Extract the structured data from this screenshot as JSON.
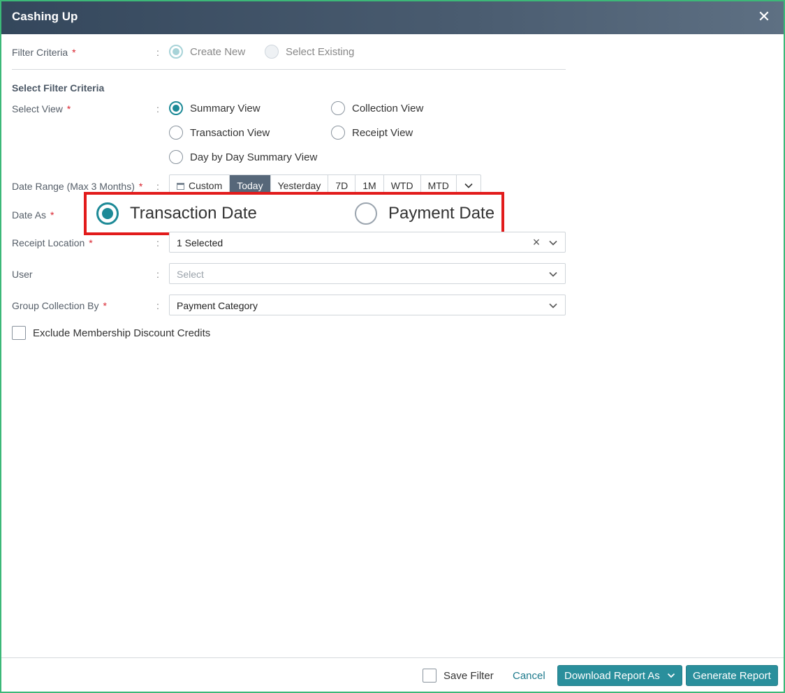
{
  "window": {
    "title": "Cashing Up"
  },
  "filter_criteria": {
    "label": "Filter Criteria",
    "required": "*",
    "options": [
      {
        "label": "Create New",
        "selected": true,
        "disabled": true
      },
      {
        "label": "Select Existing",
        "selected": false,
        "disabled": true
      }
    ]
  },
  "section_title": "Select Filter Criteria",
  "select_view": {
    "label": "Select View",
    "required": "*",
    "options": [
      {
        "label": "Summary View",
        "selected": true
      },
      {
        "label": "Collection View",
        "selected": false
      },
      {
        "label": "Transaction View",
        "selected": false
      },
      {
        "label": "Receipt View",
        "selected": false
      },
      {
        "label": "Day by Day Summary View",
        "selected": false
      }
    ]
  },
  "date_range": {
    "label": "Date Range (Max 3 Months)",
    "required": "*",
    "buttons": [
      "Custom",
      "Today",
      "Yesterday",
      "7D",
      "1M",
      "WTD",
      "MTD"
    ],
    "active": "Today"
  },
  "date_as": {
    "label": "Date As",
    "required": "*",
    "options": [
      {
        "label": "Transaction Date",
        "selected": true
      },
      {
        "label": "Payment Date",
        "selected": false
      }
    ]
  },
  "receipt_location": {
    "label": "Receipt Location",
    "required": "*",
    "value": "1 Selected"
  },
  "user": {
    "label": "User",
    "placeholder": "Select"
  },
  "group_collection_by": {
    "label": "Group Collection By",
    "required": "*",
    "value": "Payment Category"
  },
  "exclude_membership": {
    "label": "Exclude Membership Discount Credits",
    "checked": false
  },
  "footer": {
    "save_filter": "Save Filter",
    "cancel": "Cancel",
    "download": "Download Report As",
    "generate": "Generate Report"
  },
  "colon": ":",
  "colors": {
    "accent": "#1d8a97",
    "highlight": "#e21b1b",
    "titlebar": "#34475c"
  }
}
